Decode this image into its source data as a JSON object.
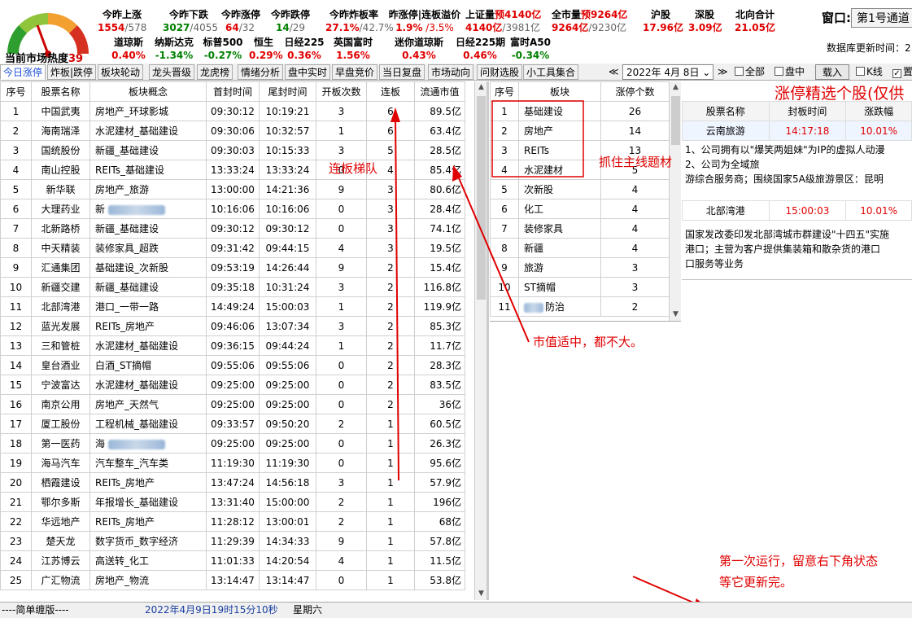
{
  "heat": {
    "label": "当前市场热度",
    "value": "39"
  },
  "stats_row1": [
    {
      "label": "今昨上涨",
      "v1": "1554",
      "v2": "/578",
      "c1": "red",
      "c2": "gray"
    },
    {
      "label": "今昨下跌",
      "v1": "3027",
      "v2": "/4055",
      "c1": "green",
      "c2": "gray"
    },
    {
      "label": "今昨涨停",
      "v1": "64",
      "v2": "/32",
      "c1": "red",
      "c2": "gray"
    },
    {
      "label": "今昨跌停",
      "v1": "14",
      "v2": "/29",
      "c1": "green",
      "c2": "gray"
    },
    {
      "label": "今昨炸板率",
      "v1": "27.1%",
      "v2": "/42.7%",
      "c1": "red",
      "c2": "gray"
    },
    {
      "label": "昨涨停|连板溢价",
      "v1": "1.9%",
      "v2": " /3.5%",
      "c1": "red",
      "c2": "red"
    },
    {
      "label": "上证量",
      "labelx": "预4140亿",
      "v1": "4140亿",
      "v2": "/3981亿",
      "c1": "red",
      "c2": "gray"
    },
    {
      "label": "全市量",
      "labelx": "预9264亿",
      "v1": "9264亿",
      "v2": "/9230亿",
      "c1": "red",
      "c2": "gray"
    },
    {
      "label": "沪股",
      "v1": "17.96亿",
      "v2": "",
      "c1": "red",
      "c2": "red"
    },
    {
      "label": "深股",
      "v1": "3.09亿",
      "v2": "",
      "c1": "red",
      "c2": "red"
    },
    {
      "label": "北向合计",
      "v1": "21.05亿",
      "v2": "",
      "c1": "red",
      "c2": "red"
    }
  ],
  "stats_row2": [
    {
      "label": "道琼斯",
      "v": "0.40%",
      "c": "red"
    },
    {
      "label": "纳斯达克",
      "v": "-1.34%",
      "c": "green"
    },
    {
      "label": "标普500",
      "v": "-0.27%",
      "c": "green"
    },
    {
      "label": "恒生",
      "v": "0.29%",
      "c": "red"
    },
    {
      "label": "日经225",
      "v": "0.36%",
      "c": "red"
    },
    {
      "label": "英国富时",
      "v": "1.56%",
      "c": "red"
    },
    {
      "label": "迷你道琼斯",
      "v": "0.43%",
      "c": "red"
    },
    {
      "label": "日经225期",
      "v": "0.46%",
      "c": "red"
    },
    {
      "label": "富时A50",
      "v": "-0.34%",
      "c": "green"
    }
  ],
  "window": {
    "label": "窗口:",
    "value": "第1号通道"
  },
  "db_update": "数据库更新时间：2",
  "tabs": [
    "今日涨停",
    "炸板|跌停",
    "板块轮动",
    "龙头晋级",
    "龙虎榜",
    "情绪分析",
    "盘中实时",
    "早盘竞价",
    "当日复盘",
    "市场动向",
    "问财选股",
    "小工具集合"
  ],
  "controls": {
    "date": "2022年  4月  8日",
    "all": "全部",
    "intraday": "盘中",
    "load": "载入",
    "kline": "K线",
    "last": "置"
  },
  "main_table": {
    "headers": [
      "序号",
      "股票名称",
      "板块概念",
      "首封时间",
      "尾封时间",
      "开板次数",
      "连板",
      "流通市值"
    ],
    "rows": [
      [
        "1",
        "中国武夷",
        "房地产_环球影城",
        "09:30:12",
        "10:19:21",
        "3",
        "6",
        "89.5亿"
      ],
      [
        "2",
        "海南瑞泽",
        "水泥建材_基础建设",
        "09:30:06",
        "10:32:57",
        "1",
        "6",
        "63.4亿"
      ],
      [
        "3",
        "国统股份",
        "新疆_基础建设",
        "09:30:03",
        "10:15:33",
        "3",
        "5",
        "28.5亿"
      ],
      [
        "4",
        "南山控股",
        "REITs_基础建设",
        "13:33:24",
        "13:33:24",
        "0",
        "4",
        "85.4亿"
      ],
      [
        "5",
        "新华联",
        "房地产_旅游",
        "13:00:00",
        "14:21:36",
        "9",
        "3",
        "80.6亿"
      ],
      [
        "6",
        "大理药业",
        "新",
        "10:16:06",
        "10:16:06",
        "0",
        "3",
        "28.4亿"
      ],
      [
        "7",
        "北新路桥",
        "新疆_基础建设",
        "09:30:12",
        "09:30:12",
        "0",
        "3",
        "74.1亿"
      ],
      [
        "8",
        "中天精装",
        "装修家具_超跌",
        "09:31:42",
        "09:44:15",
        "4",
        "3",
        "19.5亿"
      ],
      [
        "9",
        "汇通集团",
        "基础建设_次新股",
        "09:53:19",
        "14:26:44",
        "9",
        "2",
        "15.4亿"
      ],
      [
        "10",
        "新疆交建",
        "新疆_基础建设",
        "09:35:18",
        "10:31:24",
        "3",
        "2",
        "116.8亿"
      ],
      [
        "11",
        "北部湾港",
        "港口_一带一路",
        "14:49:24",
        "15:00:03",
        "1",
        "2",
        "119.9亿"
      ],
      [
        "12",
        "蓝光发展",
        "REITs_房地产",
        "09:46:06",
        "13:07:34",
        "3",
        "2",
        "85.3亿"
      ],
      [
        "13",
        "三和管桩",
        "水泥建材_基础建设",
        "09:36:15",
        "09:44:24",
        "1",
        "2",
        "11.7亿"
      ],
      [
        "14",
        "皇台酒业",
        "白酒_ST摘帽",
        "09:55:06",
        "09:55:06",
        "0",
        "2",
        "28.3亿"
      ],
      [
        "15",
        "宁波富达",
        "水泥建材_基础建设",
        "09:25:00",
        "09:25:00",
        "0",
        "2",
        "83.5亿"
      ],
      [
        "16",
        "南京公用",
        "房地产_天然气",
        "09:25:00",
        "09:25:00",
        "0",
        "2",
        "36亿"
      ],
      [
        "17",
        "厦工股份",
        "工程机械_基础建设",
        "09:33:57",
        "09:50:20",
        "2",
        "1",
        "60.5亿"
      ],
      [
        "18",
        "第一医药",
        "海",
        "09:25:00",
        "09:25:00",
        "0",
        "1",
        "26.3亿"
      ],
      [
        "19",
        "海马汽车",
        "汽车整车_汽车类",
        "11:19:30",
        "11:19:30",
        "0",
        "1",
        "95.6亿"
      ],
      [
        "20",
        "栖霞建设",
        "REITs_房地产",
        "13:47:24",
        "14:56:18",
        "3",
        "1",
        "57.9亿"
      ],
      [
        "21",
        "鄂尔多斯",
        "年报增长_基础建设",
        "13:31:40",
        "15:00:00",
        "2",
        "1",
        "196亿"
      ],
      [
        "22",
        "华远地产",
        "REITs_房地产",
        "11:28:12",
        "13:00:01",
        "2",
        "1",
        "68亿"
      ],
      [
        "23",
        "楚天龙",
        "数字货币_数字经济",
        "11:29:39",
        "14:34:33",
        "9",
        "1",
        "57.8亿"
      ],
      [
        "24",
        "江苏博云",
        "高送转_化工",
        "11:01:33",
        "14:20:54",
        "4",
        "1",
        "11.5亿"
      ],
      [
        "25",
        "广汇物流",
        "房地产_物流",
        "13:14:47",
        "13:14:47",
        "0",
        "1",
        "53.8亿"
      ]
    ]
  },
  "sector_table": {
    "headers": [
      "序号",
      "板块",
      "涨停个数"
    ],
    "rows": [
      [
        "1",
        "基础建设",
        "26"
      ],
      [
        "2",
        "房地产",
        "14"
      ],
      [
        "3",
        "REITs",
        "13"
      ],
      [
        "4",
        "水泥建材",
        "5"
      ],
      [
        "5",
        "次新股",
        "4"
      ],
      [
        "6",
        "化工",
        "4"
      ],
      [
        "7",
        "装修家具",
        "4"
      ],
      [
        "8",
        "新疆",
        "4"
      ],
      [
        "9",
        "旅游",
        "3"
      ],
      [
        "10",
        "ST摘帽",
        "3"
      ],
      [
        "11",
        "防治",
        "2"
      ]
    ]
  },
  "right_panel": {
    "title": "涨停精选个股(仅供",
    "headers": [
      "股票名称",
      "封板时间",
      "涨跌幅"
    ],
    "stock1": {
      "name": "云南旅游",
      "time": "14:17:18",
      "chg": "10.01%"
    },
    "desc1": [
      "1、公司拥有以\"爆笑两姐妹\"为IP的虚拟人动漫",
      "2、公司为全域旅",
      "游综合服务商；围绕国家5A级旅游景区：昆明"
    ],
    "stock2": {
      "name": "北部湾港",
      "time": "15:00:03",
      "chg": "10.01%"
    },
    "desc2": [
      "国家发改委印发北部湾城市群建设\"十四五\"实施",
      "港口；主营为客户提供集装箱和散杂货的港口",
      "口服务等业务"
    ]
  },
  "annotations": {
    "ladder": "连板梯队",
    "theme": "抓住主线题材",
    "cap": "市值适中，都不大。",
    "first_run_1": "第一次运行，留意右下角状态",
    "first_run_2": "等它更新完。"
  },
  "status": {
    "version": "----简单缠版----",
    "datetime": "2022年4月9日19时15分10秒",
    "weekday": "星期六"
  }
}
